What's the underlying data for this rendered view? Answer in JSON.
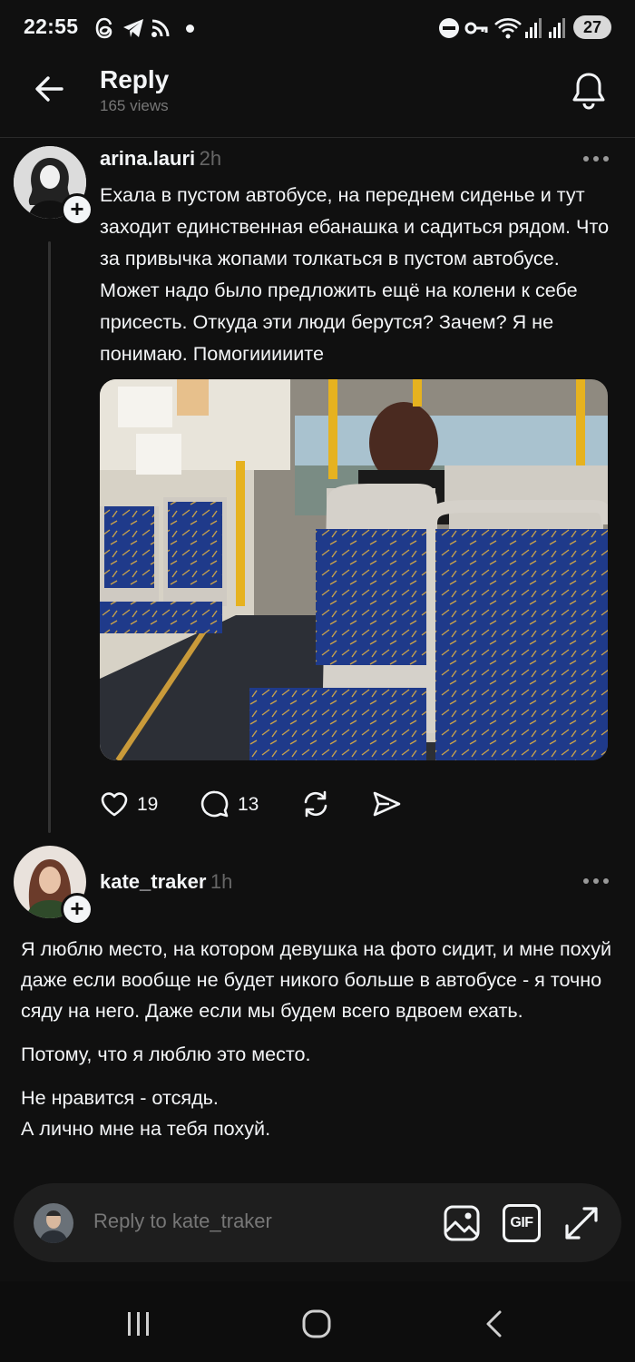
{
  "status_bar": {
    "time": "22:55",
    "battery": "27",
    "icons": [
      "threads-icon",
      "telegram-icon",
      "cast-icon",
      "dot-icon",
      "do-not-disturb-icon",
      "vpn-key-icon",
      "wifi-icon",
      "signal-icon",
      "signal-icon"
    ]
  },
  "header": {
    "title": "Reply",
    "views": "165 views",
    "icons": [
      "back-arrow-icon",
      "bell-icon"
    ]
  },
  "post": {
    "username": "arina.lauri",
    "time": "2h",
    "text": "Ехала в пустом автобусе, на переднем сиденье и тут заходит единственная ебанашка и садиться рядом. Что за привычка жопами толкаться в пустом автобусе. Может надо было предложить ещё на колени к себе присесть. Откуда эти люди берутся? Зачем? Я не понимаю. Помогииииите",
    "likes": "19",
    "comments": "13",
    "photo_description": "bus-seats-photo"
  },
  "reply": {
    "username": "kate_traker",
    "time": "1h",
    "paragraphs": [
      "Я люблю место, на котором девушка на фото сидит, и мне похуй даже если вообще не будет никого больше в автобусе - я точно сяду на него. Даже если мы будем всего вдвоем ехать.",
      "Потому, что я люблю это место.",
      "Не нравится - отсядь.\nА лично мне на тебя похуй."
    ]
  },
  "composer": {
    "placeholder": "Reply to kate_traker",
    "gif_label": "GIF"
  },
  "colors": {
    "background": "#101010",
    "text": "#f3f5f7",
    "muted": "#777777",
    "seat_fabric": "#1f3a8a"
  }
}
